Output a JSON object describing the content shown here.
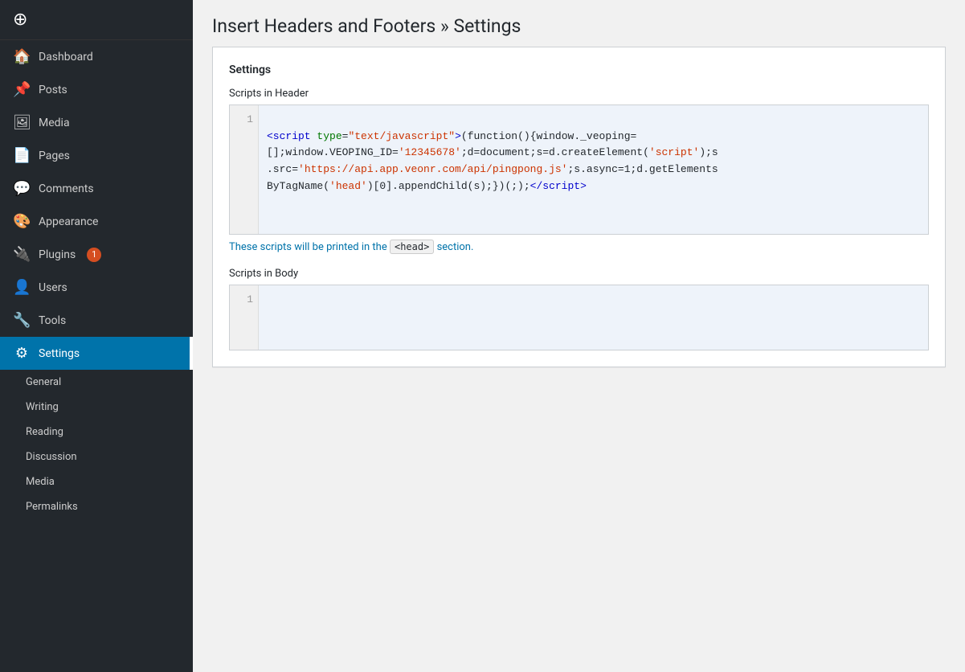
{
  "sidebar": {
    "nav_items": [
      {
        "id": "dashboard",
        "label": "Dashboard",
        "icon": "🏠",
        "active": false
      },
      {
        "id": "posts",
        "label": "Posts",
        "icon": "📌",
        "active": false
      },
      {
        "id": "media",
        "label": "Media",
        "icon": "🖼",
        "active": false
      },
      {
        "id": "pages",
        "label": "Pages",
        "icon": "📄",
        "active": false
      },
      {
        "id": "comments",
        "label": "Comments",
        "icon": "💬",
        "active": false
      },
      {
        "id": "appearance",
        "label": "Appearance",
        "icon": "🎨",
        "active": false
      },
      {
        "id": "plugins",
        "label": "Plugins",
        "icon": "🔌",
        "active": false,
        "badge": "1"
      },
      {
        "id": "users",
        "label": "Users",
        "icon": "👤",
        "active": false
      },
      {
        "id": "tools",
        "label": "Tools",
        "icon": "🔧",
        "active": false
      },
      {
        "id": "settings",
        "label": "Settings",
        "icon": "⚙",
        "active": true
      }
    ],
    "submenu_items": [
      {
        "id": "general",
        "label": "General"
      },
      {
        "id": "writing",
        "label": "Writing"
      },
      {
        "id": "reading",
        "label": "Reading"
      },
      {
        "id": "discussion",
        "label": "Discussion"
      },
      {
        "id": "media",
        "label": "Media"
      },
      {
        "id": "permalinks",
        "label": "Permalinks"
      }
    ]
  },
  "page": {
    "title": "Insert Headers and Footers » Settings"
  },
  "settings_panel": {
    "heading": "Settings",
    "header_section": {
      "label": "Scripts in Header",
      "line1": "1",
      "code_html": "&lt;<span class='tag'>script</span> <span class='attr-name'>type</span>=<span class='attr-value'>\"text/javascript\"</span>&gt;(function(){window._veoping=[];window.VEOPING_ID=<span class='string'>'12345678'</span>;d=document;s=d.createElement(<span class='string'>'script'</span>);s.src=<span class='string'>'https://api.app.veonr.com/api/pingpong.js'</span>;s.async=1;d.getElementsByTagName(<span class='string'>'head'</span>)[0].appendChild(s);})(;);&lt;/<span class='tag'>script</span>&gt;",
      "hint_prefix": "These scripts will be printed in the",
      "hint_tag": "<head>",
      "hint_suffix": "section."
    },
    "body_section": {
      "label": "Scripts in Body",
      "line1": "1"
    }
  },
  "colors": {
    "sidebar_bg": "#23282d",
    "active_bg": "#0073aa",
    "accent": "#0073aa",
    "badge_bg": "#d54e21",
    "code_bg": "#eef3fa"
  }
}
